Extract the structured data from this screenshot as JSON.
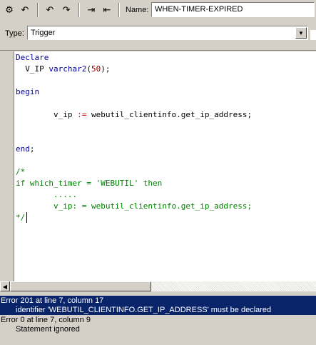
{
  "toolbar": {
    "buttons": [
      {
        "name": "compile-icon",
        "glyph": "⚙"
      },
      {
        "name": "revert-icon",
        "glyph": "↶"
      },
      {
        "name": "undo-icon",
        "glyph": "↶"
      },
      {
        "name": "redo-icon",
        "glyph": "↷"
      },
      {
        "name": "indent-icon",
        "glyph": "⇥"
      },
      {
        "name": "outdent-icon",
        "glyph": "⇤"
      }
    ],
    "name_label": "Name:",
    "name_value": "WHEN-TIMER-EXPIRED"
  },
  "type_row": {
    "label": "Type:",
    "value": "Trigger",
    "arrow_glyph": "▼"
  },
  "editor": {
    "lines": [
      {
        "segments": [
          {
            "text": "Declare",
            "cls": "kw"
          }
        ]
      },
      {
        "segments": [
          {
            "text": "  V_IP ",
            "cls": ""
          },
          {
            "text": "varchar2",
            "cls": "kw"
          },
          {
            "text": "(",
            "cls": ""
          },
          {
            "text": "50",
            "cls": "num"
          },
          {
            "text": ");",
            "cls": ""
          }
        ]
      },
      {
        "segments": []
      },
      {
        "segments": [
          {
            "text": "begin",
            "cls": "kw"
          }
        ]
      },
      {
        "segments": []
      },
      {
        "segments": [
          {
            "text": "        v_ip ",
            "cls": ""
          },
          {
            "text": ":=",
            "cls": "op"
          },
          {
            "text": " webutil_clientinfo.get_ip_address;",
            "cls": ""
          }
        ]
      },
      {
        "segments": []
      },
      {
        "segments": []
      },
      {
        "segments": [
          {
            "text": "end",
            "cls": "kw"
          },
          {
            "text": ";",
            "cls": ""
          }
        ]
      },
      {
        "segments": []
      },
      {
        "segments": [
          {
            "text": "/*",
            "cls": "cm"
          }
        ]
      },
      {
        "segments": [
          {
            "text": "if which_timer = 'WEBUTIL' then",
            "cls": "cm"
          }
        ]
      },
      {
        "segments": [
          {
            "text": "        .....",
            "cls": "cm"
          }
        ]
      },
      {
        "segments": [
          {
            "text": "        v_ip: = webutil_clientinfo.get_ip_address;",
            "cls": "cm"
          }
        ]
      },
      {
        "segments": [
          {
            "text": "*/",
            "cls": "cm"
          }
        ]
      }
    ]
  },
  "scrollbar": {
    "left_glyph": "◀"
  },
  "messages": {
    "selected_title": "Error 201 at line 7, column 17",
    "selected_detail": "identifier 'WEBUTIL_CLIENTINFO.GET_IP_ADDRESS' must be declared",
    "other_title": "Error 0 at line 7, column 9",
    "other_detail": "Statement ignored"
  }
}
